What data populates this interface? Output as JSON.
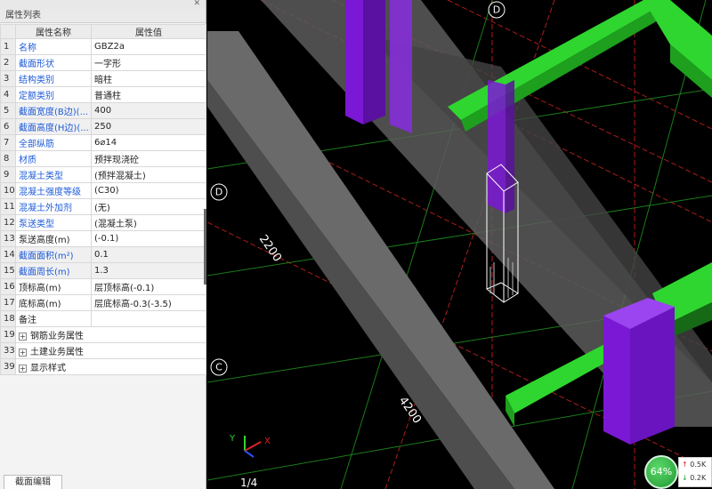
{
  "panel": {
    "header": "属性列表",
    "pin_icon": "close-icon",
    "columns": {
      "name": "属性名称",
      "value": "属性值"
    },
    "rows": [
      {
        "idx": "1",
        "name": "名称",
        "value": "GBZ2a",
        "name_style": "blue"
      },
      {
        "idx": "2",
        "name": "截面形状",
        "value": "一字形",
        "name_style": "blue"
      },
      {
        "idx": "3",
        "name": "结构类别",
        "value": "暗柱",
        "name_style": "blue"
      },
      {
        "idx": "4",
        "name": "定额类别",
        "value": "普通柱",
        "name_style": "blue"
      },
      {
        "idx": "5",
        "name": "截面宽度(B边)(...",
        "value": "400",
        "name_style": "blue",
        "readonly": true
      },
      {
        "idx": "6",
        "name": "截面高度(H边)(...",
        "value": "250",
        "name_style": "blue",
        "readonly": true
      },
      {
        "idx": "7",
        "name": "全部纵筋",
        "value": "6⌀14",
        "name_style": "blue"
      },
      {
        "idx": "8",
        "name": "材质",
        "value": "预拌现浇砼",
        "name_style": "blue"
      },
      {
        "idx": "9",
        "name": "混凝土类型",
        "value": "(预拌混凝土)",
        "name_style": "blue"
      },
      {
        "idx": "10",
        "name": "混凝土强度等级",
        "value": "(C30)",
        "name_style": "blue"
      },
      {
        "idx": "11",
        "name": "混凝土外加剂",
        "value": "(无)",
        "name_style": "blue"
      },
      {
        "idx": "12",
        "name": "泵送类型",
        "value": "(混凝土泵)",
        "name_style": "blue"
      },
      {
        "idx": "13",
        "name": "泵送高度(m)",
        "value": "(-0.1)",
        "name_style": "black"
      },
      {
        "idx": "14",
        "name": "截面面积(m²)",
        "value": "0.1",
        "name_style": "blue",
        "readonly": true
      },
      {
        "idx": "15",
        "name": "截面周长(m)",
        "value": "1.3",
        "name_style": "blue",
        "readonly": true
      },
      {
        "idx": "16",
        "name": "顶标高(m)",
        "value": "层顶标高(-0.1)",
        "name_style": "black"
      },
      {
        "idx": "17",
        "name": "底标高(m)",
        "value": "层底标高-0.3(-3.5)",
        "name_style": "black"
      },
      {
        "idx": "18",
        "name": "备注",
        "value": "",
        "name_style": "black"
      }
    ],
    "groups": [
      {
        "idx": "19",
        "label": "钢筋业务属性"
      },
      {
        "idx": "33",
        "label": "土建业务属性"
      },
      {
        "idx": "39",
        "label": "显示样式"
      }
    ],
    "expand_symbol": "+",
    "bottom_tab": "截面编辑"
  },
  "viewport": {
    "grid_labels": [
      "D",
      "D",
      "C"
    ],
    "dimensions": [
      "2200",
      "4200"
    ],
    "axis": {
      "x": "X",
      "y": "Y"
    },
    "page_indicator": "1/4",
    "colors": {
      "beam_green": "#2fd62f",
      "column_purple": "#7b18d6",
      "slab_gray": "#5f5f5f",
      "grid_red": "#c02020",
      "grid_green": "#1f8a1f"
    }
  },
  "network": {
    "percent": "64%",
    "up": "0.5K",
    "down": "0.2K",
    "up_arrow": "↑",
    "down_arrow": "↓"
  }
}
